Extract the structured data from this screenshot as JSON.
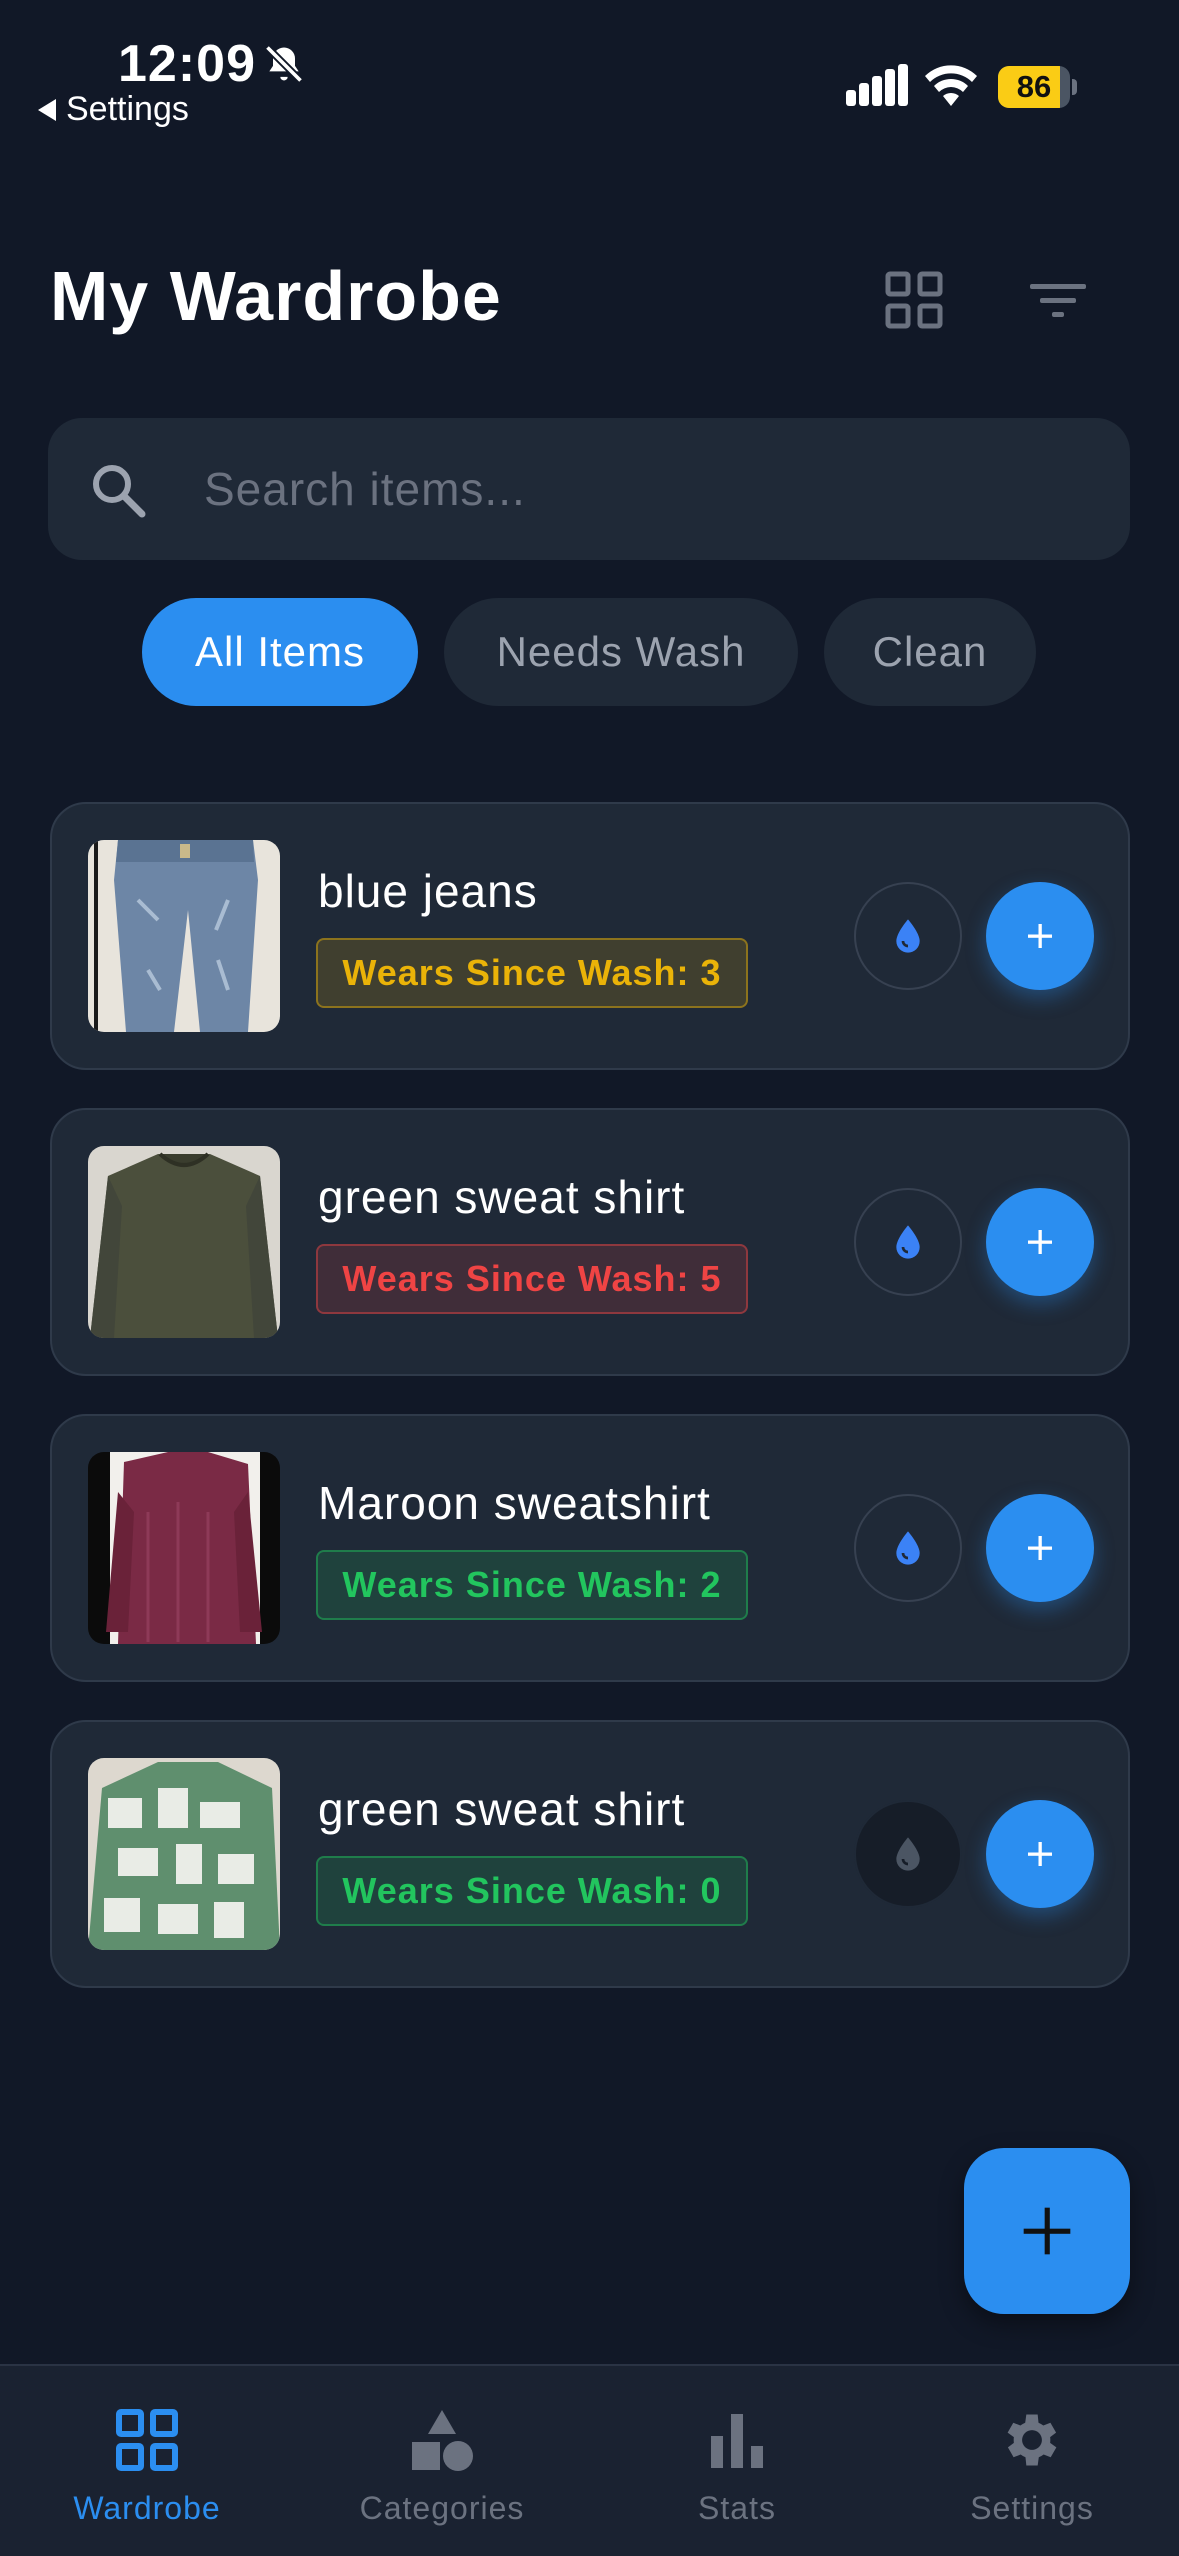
{
  "status_bar": {
    "time": "12:09",
    "back_label": "Settings",
    "battery_level": "86",
    "battery_color": "#facc15"
  },
  "header": {
    "title": "My Wardrobe"
  },
  "search": {
    "placeholder": "Search items..."
  },
  "filters": [
    {
      "label": "All Items",
      "active": true
    },
    {
      "label": "Needs Wash",
      "active": false
    },
    {
      "label": "Clean",
      "active": false
    }
  ],
  "items": [
    {
      "name": "blue jeans",
      "wears_label": "Wears Since Wash: 3",
      "status": "warning"
    },
    {
      "name": "green sweat shirt",
      "wears_label": "Wears Since Wash: 5",
      "status": "danger"
    },
    {
      "name": "Maroon sweatshirt",
      "wears_label": "Wears Since Wash: 2",
      "status": "ok"
    },
    {
      "name": "green sweat shirt",
      "wears_label": "Wears Since Wash: 0",
      "status": "ok"
    }
  ],
  "nav": [
    {
      "label": "Wardrobe",
      "icon": "grid-icon",
      "active": true
    },
    {
      "label": "Categories",
      "icon": "shapes-icon",
      "active": false
    },
    {
      "label": "Stats",
      "icon": "bar-chart-icon",
      "active": false
    },
    {
      "label": "Settings",
      "icon": "gear-icon",
      "active": false
    }
  ],
  "colors": {
    "accent": "#2b8ef0",
    "background": "#111827",
    "card": "#1f2937",
    "warning": "#eab308",
    "danger": "#ef4444",
    "ok": "#22c55e"
  }
}
